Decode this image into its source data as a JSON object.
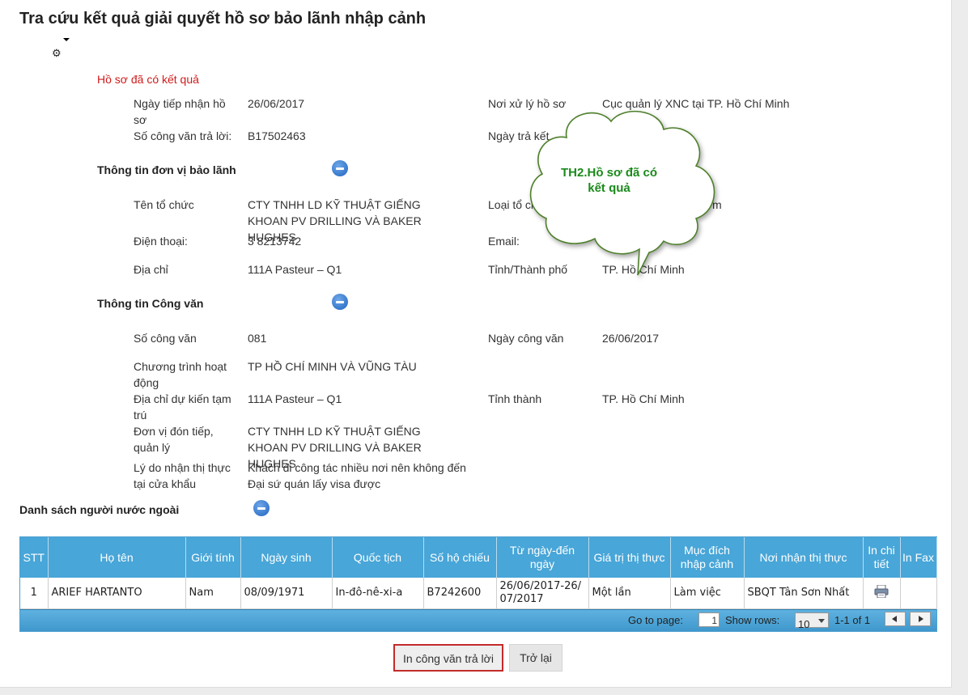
{
  "page_title": "Tra cứu kết quả giải quyết hồ sơ bảo lãnh nhập cảnh",
  "status_text": "Hồ sơ đã có kết quả",
  "general": {
    "receive_date_label": "Ngày tiếp nhận hồ sơ",
    "receive_date_value": "26/06/2017",
    "processing_place_label": "Nơi xử lý hồ sơ",
    "processing_place_value": "Cục quản lý XNC tại TP. Hồ Chí Minh",
    "reply_no_label": "Số công văn trả lời:",
    "reply_no_value": "B17502463",
    "result_date_label": "Ngày trả kết"
  },
  "guarantor_section": {
    "title": "Thông tin đơn vị bảo lãnh",
    "org_name_label": "Tên tổ chức",
    "org_name_value": "CTY TNHH LD KỸ THUẬT GIẾNG KHOAN PV DRILLING VÀ BAKER HUGHES",
    "org_type_label": "Loại tổ ch",
    "org_type_value": "m",
    "phone_label": "Điện thoại:",
    "phone_value": "3 8213742",
    "email_label": "Email:",
    "address_label": "Địa chỉ",
    "address_value": "111A Pasteur – Q1",
    "province_label": "Tỉnh/Thành phố",
    "province_value": "TP. Hồ Chí Minh"
  },
  "letter_section": {
    "title": "Thông tin Công văn",
    "letter_no_label": "Số công văn",
    "letter_no_value": "081",
    "letter_date_label": "Ngày công văn",
    "letter_date_value": "26/06/2017",
    "program_label": "Chương trình hoạt động",
    "program_value": "TP HỒ CHÍ MINH VÀ VŨNG TÀU",
    "temp_address_label": "Địa chỉ dự kiến tạm trú",
    "temp_address_value": "111A Pasteur – Q1",
    "city_label": "Tỉnh thành",
    "city_value": "TP. Hồ Chí Minh",
    "host_unit_label": "Đơn vị đón tiếp, quản lý",
    "host_unit_value": "CTY TNHH LD KỸ THUẬT GIẾNG KHOAN PV DRILLING VÀ BAKER HUGHES",
    "visa_reason_label": "Lý do nhận thị thực tại cửa khẩu",
    "visa_reason_value": "Khách đi công tác nhiều nơi nên không đến Đại sứ quán lấy visa được"
  },
  "foreigners_section": {
    "title": "Danh sách người nước ngoài",
    "columns": [
      "STT",
      "Họ tên",
      "Giới tính",
      "Ngày sinh",
      "Quốc tịch",
      "Số hộ chiếu",
      "Từ ngày-đến ngày",
      "Giá trị thị thực",
      "Mục đích nhập cảnh",
      "Nơi nhận thị thực",
      "In chi tiết",
      "In Fax"
    ],
    "rows": [
      {
        "stt": "1",
        "name": "ARIEF HARTANTO",
        "gender": "Nam",
        "dob": "08/09/1971",
        "nationality": "In-đô-nê-xi-a",
        "passport": "B7242600",
        "period": "26/06/2017-26/07/2017",
        "visa_value": "Một lần",
        "purpose": "Làm việc",
        "visa_place": "SBQT Tân Sơn Nhất",
        "print_icon": "printer-icon"
      }
    ],
    "pager": {
      "go_to_page_label": "Go to page:",
      "page_value": "1",
      "show_rows_label": "Show rows:",
      "rows_value": "10",
      "range_text": "1-1 of 1"
    }
  },
  "callout": {
    "text": "TH2.Hồ sơ đã có kết quả",
    "color": "#1b8a1b"
  },
  "buttons": {
    "print_reply": "In công văn trả lời",
    "back": "Trở lại"
  },
  "colors": {
    "status": "#d01a1a",
    "grid_header": "#48a6d8",
    "highlight_border": "#c42a2a"
  }
}
